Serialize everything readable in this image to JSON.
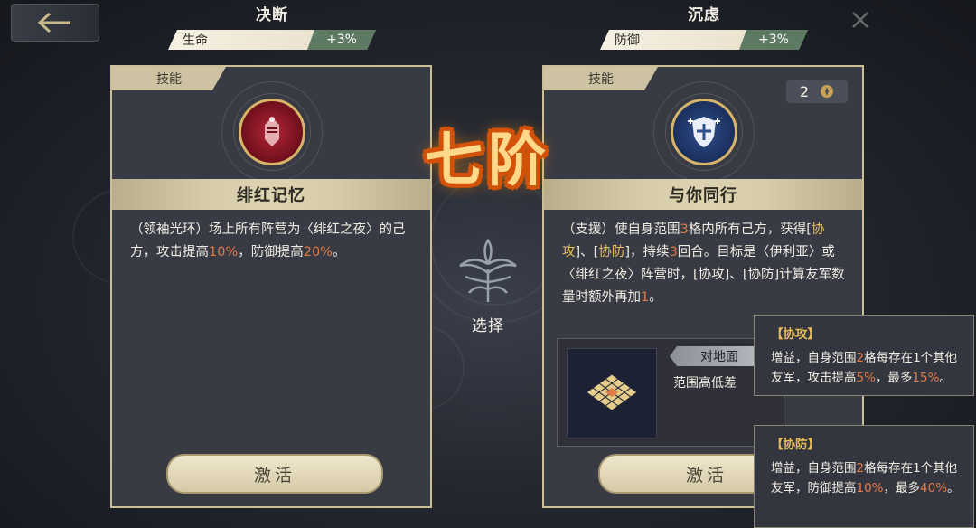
{
  "colors": {
    "accent_orange": "#e27b46",
    "accent_gold": "#e7bd5a",
    "buff_green": "#5d7a62",
    "card_border": "#cbbf9a"
  },
  "left_buff": {
    "name": "决断",
    "stat": "生命",
    "value": "+3%"
  },
  "right_buff": {
    "name": "沉虑",
    "stat": "防御",
    "value": "+3%"
  },
  "left_card": {
    "tab": "技能",
    "icon": "crimson-memory-icon",
    "skill_name": "绯红记忆",
    "desc": [
      {
        "t": "（领袖光环）场上所有阵营为〈绯红之夜〉的己方，攻击提高"
      },
      {
        "t": "10%",
        "c": "o"
      },
      {
        "t": "，防御提高"
      },
      {
        "t": "20%",
        "c": "o"
      },
      {
        "t": "。"
      }
    ],
    "button": "激活"
  },
  "right_card": {
    "tab": "技能",
    "cost": "2",
    "icon": "shield-cross-icon",
    "skill_name": "与你同行",
    "desc": [
      {
        "t": "（支援）使自身范围"
      },
      {
        "t": "3",
        "c": "o"
      },
      {
        "t": "格内所有己方，获得["
      },
      {
        "t": "协攻",
        "c": "y"
      },
      {
        "t": "]、["
      },
      {
        "t": "协防",
        "c": "y"
      },
      {
        "t": "]，持续"
      },
      {
        "t": "3",
        "c": "o"
      },
      {
        "t": "回合。目标是〈伊利亚〉或〈绯红之夜〉阵营时，[协攻]、[协防]计算友军数量时额外再加"
      },
      {
        "t": "1",
        "c": "o"
      },
      {
        "t": "。"
      }
    ],
    "terrain": "对地面",
    "terrain_sub": "范围高低差",
    "button": "激活"
  },
  "center": {
    "rank": "七阶",
    "select_label": "选择"
  },
  "tooltips": [
    {
      "title": "【协攻】",
      "desc": [
        {
          "t": "增益，自身范围"
        },
        {
          "t": "2",
          "c": "o"
        },
        {
          "t": "格每存在1个其他友军，攻击提高"
        },
        {
          "t": "5%",
          "c": "o"
        },
        {
          "t": "，最多"
        },
        {
          "t": "15%",
          "c": "o"
        },
        {
          "t": "。"
        }
      ]
    },
    {
      "title": "【协防】",
      "desc": [
        {
          "t": "增益，自身范围"
        },
        {
          "t": "2",
          "c": "o"
        },
        {
          "t": "格每存在1个其他友军，防御提高"
        },
        {
          "t": "10%",
          "c": "o"
        },
        {
          "t": "，最多"
        },
        {
          "t": "40%",
          "c": "o"
        },
        {
          "t": "。"
        }
      ]
    }
  ]
}
